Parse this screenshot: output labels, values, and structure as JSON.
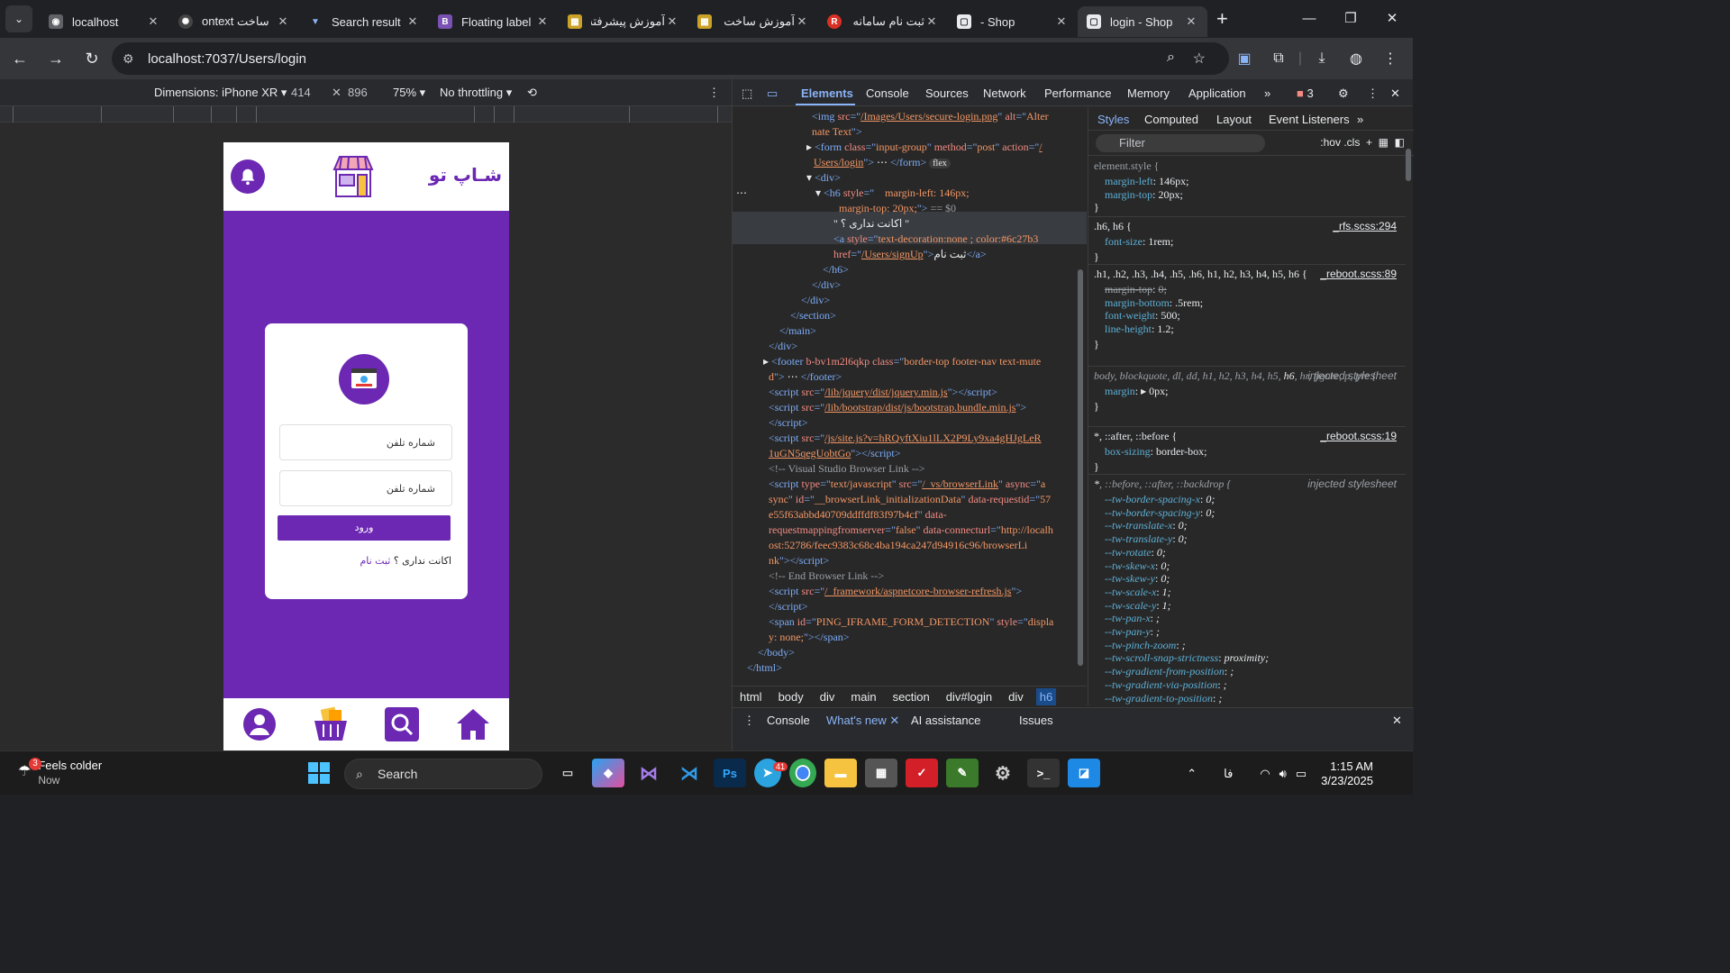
{
  "browser": {
    "tabs": [
      {
        "title": "localhost",
        "active": false
      },
      {
        "title": "ontext ساخت",
        "active": false
      },
      {
        "title": "Search result",
        "active": false
      },
      {
        "title": "Floating label",
        "active": false
      },
      {
        "title": "آموزش پیشرفته",
        "active": false
      },
      {
        "title": "آموزش ساخت",
        "active": false
      },
      {
        "title": "ثبت نام سامانه",
        "active": false
      },
      {
        "title": "- Shop",
        "active": false
      },
      {
        "title": "login - Shop",
        "active": true
      }
    ],
    "url": "localhost:7037/Users/login"
  },
  "device_toolbar": {
    "dimensions_label": "Dimensions: iPhone XR",
    "width": "414",
    "height": "896",
    "zoom": "75%",
    "throttling": "No throttling"
  },
  "phone": {
    "brand": "شـاپ تو",
    "field1_placeholder": "شماره تلفن",
    "field2_placeholder": "شماره تلفن",
    "submit_label": "ورود",
    "signup_text": "اکانت نداری ؟",
    "signup_link": "ثبت نام",
    "accent_color": "#6c27b3"
  },
  "devtools": {
    "tabs": [
      "Elements",
      "Console",
      "Sources",
      "Network",
      "Performance",
      "Memory",
      "Application"
    ],
    "issues_count": "3",
    "breadcrumb": [
      "html",
      "body",
      "div",
      "main",
      "section",
      "div#login",
      "div",
      "h6"
    ],
    "styles_tabs": [
      "Styles",
      "Computed",
      "Layout",
      "Event Listeners"
    ],
    "filter_placeholder": "Filter",
    "filter_opts": ":hov .cls",
    "drawer_tabs": [
      "Console",
      "What's new",
      "AI assistance",
      "Issues"
    ]
  },
  "taskbar": {
    "weather_title": "Feels colder",
    "weather_sub": "Now",
    "notif_count": "3",
    "search_label": "Search",
    "lang": "فا",
    "time": "1:15 AM",
    "date": "3/23/2025",
    "telegram_badge": "41"
  }
}
